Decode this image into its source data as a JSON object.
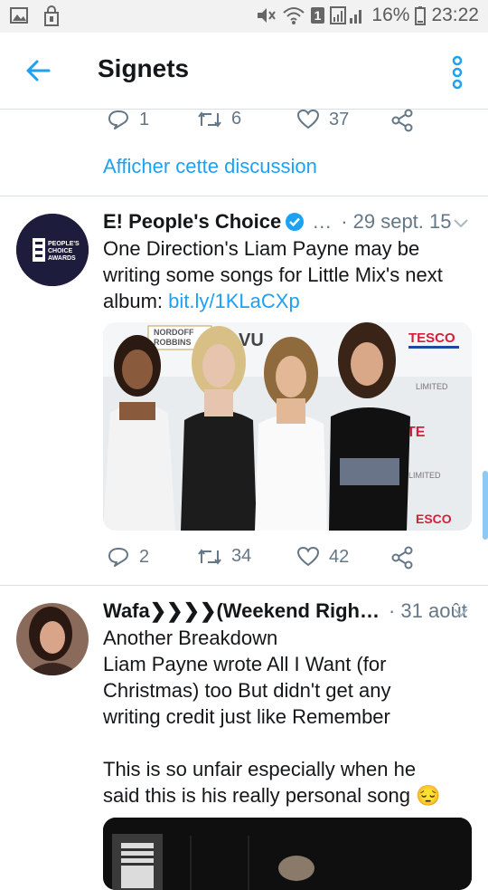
{
  "status_bar": {
    "battery": "16%",
    "time": "23:22",
    "sim": "1",
    "icons": [
      "image-icon",
      "store-icon",
      "mute-icon",
      "wifi-icon",
      "signal-icon",
      "battery-icon"
    ]
  },
  "header": {
    "title": "Signets",
    "back_icon": "arrow-left-icon",
    "menu_icon": "overflow-menu-icon"
  },
  "tweet0": {
    "replies": "1",
    "retweets": "6",
    "likes": "37",
    "thread_link": "Afficher cette discussion"
  },
  "tweet1": {
    "name": "E! People's Choice",
    "handle": "…",
    "date": "· 29 sept. 15",
    "text": "One Direction's Liam Payne may be writing some songs for Little Mix's next album: ",
    "link": "bit.ly/1KLaCXp",
    "avatar_text": [
      "PEOPLE'S",
      "CHOICE",
      "AWARDS"
    ],
    "media_labels": [
      "NORDOFF",
      "ROBBINS",
      "TESCO",
      "LIMITED",
      "TE",
      "LIMITED",
      "ESCO",
      "VU"
    ],
    "replies": "2",
    "retweets": "34",
    "likes": "42"
  },
  "tweet2": {
    "name": "Wafa❯❯❯❯(Weekend Righ…",
    "date": "· 31 août",
    "lines": [
      "Another Breakdown",
      "Liam Payne wrote All I Want (for",
      "Christmas) too But didn't get any",
      "writing credit just like Remember",
      "",
      "This is so unfair especially when he",
      "said this is his really personal song"
    ],
    "emoji": "😔"
  },
  "colors": {
    "accent": "#1da1f2",
    "muted": "#657786",
    "divider": "#d7dfe5"
  }
}
